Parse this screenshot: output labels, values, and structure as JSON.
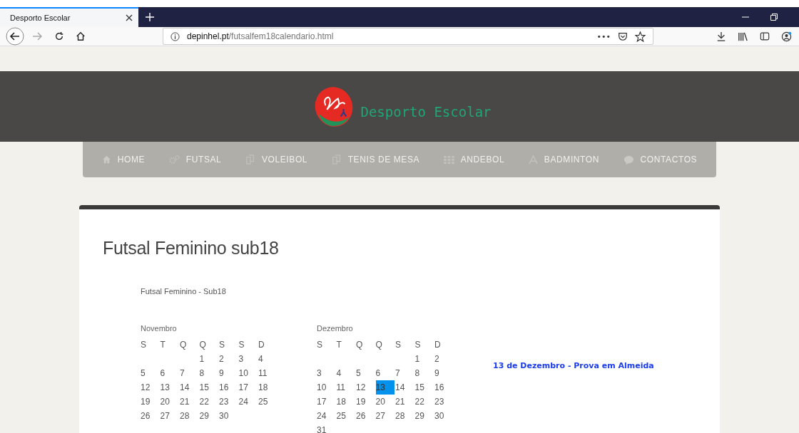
{
  "browser": {
    "tab_title": "Desporto Escolar",
    "url_domain": "depinhel.pt",
    "url_path": "/futsalfem18calendario.html",
    "page_actions": "•••"
  },
  "site": {
    "logo_text": "Desporto Escolar",
    "nav": [
      {
        "label": "HOME",
        "selected": false
      },
      {
        "label": "FUTSAL",
        "selected": false
      },
      {
        "label": "VOLEIBOL",
        "selected": false
      },
      {
        "label": "TENIS DE MESA",
        "selected": false
      },
      {
        "label": "ANDEBOL",
        "selected": false
      },
      {
        "label": "BADMINTON",
        "selected": false
      },
      {
        "label": "CONTACTOS",
        "selected": false
      }
    ]
  },
  "content": {
    "title": "Futsal Feminino sub18",
    "subtitle": "Futsal Feminino - Sub18",
    "months": [
      {
        "name": "Novembro",
        "weekdays": [
          "S",
          "T",
          "Q",
          "Q",
          "S",
          "S",
          "D"
        ],
        "weeks": [
          [
            {
              "day": "1",
              "highlighted": false
            },
            {
              "day": "2",
              "highlighted": false
            },
            {
              "day": "3",
              "highlighted": false
            },
            {
              "day": "4",
              "highlighted": false
            }
          ],
          [
            {
              "day": "5",
              "highlighted": false
            },
            {
              "day": "6",
              "highlighted": false
            },
            {
              "day": "7",
              "highlighted": false
            },
            {
              "day": "8",
              "highlighted": false
            },
            {
              "day": "9",
              "highlighted": false
            },
            {
              "day": "10",
              "highlighted": false
            },
            {
              "day": "11",
              "highlighted": false
            }
          ],
          [
            {
              "day": "12",
              "highlighted": false
            },
            {
              "day": "13",
              "highlighted": false
            },
            {
              "day": "14",
              "highlighted": false
            },
            {
              "day": "15",
              "highlighted": false
            },
            {
              "day": "16",
              "highlighted": false
            },
            {
              "day": "17",
              "highlighted": false
            },
            {
              "day": "18",
              "highlighted": false
            }
          ],
          [
            {
              "day": "19",
              "highlighted": false
            },
            {
              "day": "20",
              "highlighted": false
            },
            {
              "day": "21",
              "highlighted": false
            },
            {
              "day": "22",
              "highlighted": false
            },
            {
              "day": "23",
              "highlighted": false
            },
            {
              "day": "24",
              "highlighted": false
            },
            {
              "day": "25",
              "highlighted": false
            }
          ],
          [
            {
              "day": "26",
              "highlighted": false
            },
            {
              "day": "27",
              "highlighted": false
            },
            {
              "day": "28",
              "highlighted": false
            },
            {
              "day": "29",
              "highlighted": false
            },
            {
              "day": "30",
              "highlighted": false
            }
          ]
        ]
      },
      {
        "name": "Dezembro",
        "weekdays": [
          "S",
          "T",
          "Q",
          "Q",
          "S",
          "S",
          "D"
        ],
        "weeks": [
          [
            {
              "day": "1",
              "highlighted": false
            },
            {
              "day": "2",
              "highlighted": false
            }
          ],
          [
            {
              "day": "3",
              "highlighted": false
            },
            {
              "day": "4",
              "highlighted": false
            },
            {
              "day": "5",
              "highlighted": false
            },
            {
              "day": "6",
              "highlighted": false
            },
            {
              "day": "7",
              "highlighted": false
            },
            {
              "day": "8",
              "highlighted": false
            },
            {
              "day": "9",
              "highlighted": false
            }
          ],
          [
            {
              "day": "10",
              "highlighted": false
            },
            {
              "day": "11",
              "highlighted": false
            },
            {
              "day": "12",
              "highlighted": false
            },
            {
              "day": "13",
              "highlighted": true
            },
            {
              "day": "14",
              "highlighted": false
            },
            {
              "day": "15",
              "highlighted": false
            },
            {
              "day": "16",
              "highlighted": false
            }
          ],
          [
            {
              "day": "17",
              "highlighted": false
            },
            {
              "day": "18",
              "highlighted": false
            },
            {
              "day": "19",
              "highlighted": false
            },
            {
              "day": "20",
              "highlighted": false
            },
            {
              "day": "21",
              "highlighted": false
            },
            {
              "day": "22",
              "highlighted": false
            },
            {
              "day": "23",
              "highlighted": false
            }
          ],
          [
            {
              "day": "24",
              "highlighted": false
            },
            {
              "day": "25",
              "highlighted": false
            },
            {
              "day": "26",
              "highlighted": false
            },
            {
              "day": "27",
              "highlighted": false
            },
            {
              "day": "28",
              "highlighted": false
            },
            {
              "day": "29",
              "highlighted": false
            },
            {
              "day": "30",
              "highlighted": false
            }
          ],
          [
            {
              "day": "31",
              "highlighted": false
            }
          ]
        ]
      }
    ],
    "events": [
      "13 de Dezembro - Prova em Almeida"
    ]
  }
}
